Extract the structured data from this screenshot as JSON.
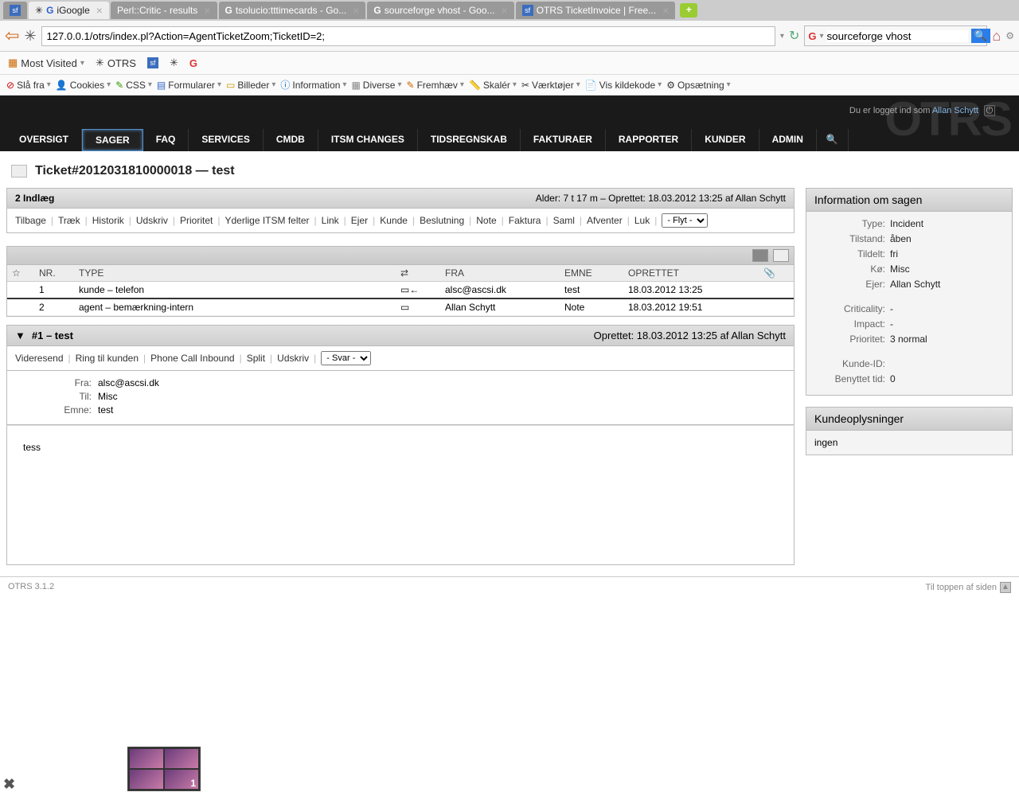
{
  "browser_tabs": [
    {
      "label": "iGoogle"
    },
    {
      "label": "Perl::Critic - results"
    },
    {
      "label": "tsolucio:tttimecards - Go..."
    },
    {
      "label": "sourceforge vhost - Goo..."
    },
    {
      "label": "OTRS TicketInvoice | Free..."
    }
  ],
  "nav": {
    "url": "127.0.0.1/otrs/index.pl?Action=AgentTicketZoom;TicketID=2;",
    "search_value": "sourceforge vhost"
  },
  "bookmarks": {
    "most_visited": "Most Visited",
    "otrs": "OTRS"
  },
  "wd_toolbar": [
    "Slå fra",
    "Cookies",
    "CSS",
    "Formularer",
    "Billeder",
    "Information",
    "Diverse",
    "Fremhæv",
    "Skalér",
    "Værktøjer",
    "Vis kildekode",
    "Opsætning"
  ],
  "header": {
    "login_prefix": "Du er logget ind som ",
    "login_user": "Allan Schytt",
    "watermark": "OTRS",
    "nav": [
      "OVERSIGT",
      "SAGER",
      "FAQ",
      "SERVICES",
      "CMDB",
      "ITSM CHANGES",
      "TIDSREGNSKAB",
      "FAKTURAER",
      "RAPPORTER",
      "KUNDER",
      "ADMIN"
    ]
  },
  "ticket_title": "Ticket#2012031810000018  —  test",
  "entries_panel": {
    "count": "2 Indlæg",
    "meta": "Alder: 7 t 17 m – Oprettet: 18.03.2012 13:25 af Allan Schytt"
  },
  "actions": [
    "Tilbage",
    "Træk",
    "Historik",
    "Udskriv",
    "Prioritet",
    "Yderlige ITSM felter",
    "Link",
    "Ejer",
    "Kunde",
    "Beslutning",
    "Note",
    "Faktura",
    "Saml",
    "Afventer",
    "Luk"
  ],
  "move_select": "- Flyt -",
  "table": {
    "headers": {
      "nr": "NR.",
      "type": "TYPE",
      "fra": "FRA",
      "emne": "EMNE",
      "oprettet": "OPRETTET"
    },
    "rows": [
      {
        "nr": "1",
        "type": "kunde – telefon",
        "arrow": "▭←",
        "fra": "alsc@ascsi.dk",
        "emne": "test",
        "oprettet": "18.03.2012 13:25"
      },
      {
        "nr": "2",
        "type": "agent – bemærkning-intern",
        "arrow": "▭",
        "fra": "Allan Schytt",
        "emne": "Note",
        "oprettet": "18.03.2012 19:51"
      }
    ]
  },
  "article": {
    "title": "#1 – test",
    "meta": "Oprettet: 18.03.2012 13:25 af Allan Schytt",
    "actions": [
      "Videresend",
      "Ring til kunden",
      "Phone Call Inbound",
      "Split",
      "Udskriv"
    ],
    "svar_select": "- Svar -",
    "fields": {
      "fra_label": "Fra:",
      "fra": "alsc@ascsi.dk",
      "til_label": "Til:",
      "til": "Misc",
      "emne_label": "Emne:",
      "emne": "test"
    },
    "body": "tess"
  },
  "info_box": {
    "title": "Information om sagen",
    "rows": [
      {
        "k": "Type:",
        "v": "Incident"
      },
      {
        "k": "Tilstand:",
        "v": "åben"
      },
      {
        "k": "Tildelt:",
        "v": "fri"
      },
      {
        "k": "Kø:",
        "v": "Misc"
      },
      {
        "k": "Ejer:",
        "v": "Allan Schytt"
      }
    ],
    "rows2": [
      {
        "k": "Criticality:",
        "v": "-"
      },
      {
        "k": "Impact:",
        "v": "-"
      },
      {
        "k": "Prioritet:",
        "v": "3 normal"
      }
    ],
    "rows3": [
      {
        "k": "Kunde-ID:",
        "v": ""
      },
      {
        "k": "Benyttet tid:",
        "v": "0"
      }
    ]
  },
  "customer_box": {
    "title": "Kundeoplysninger",
    "none": "ingen"
  },
  "footer": {
    "version": "OTRS 3.1.2",
    "top_link": "Til toppen af siden"
  }
}
